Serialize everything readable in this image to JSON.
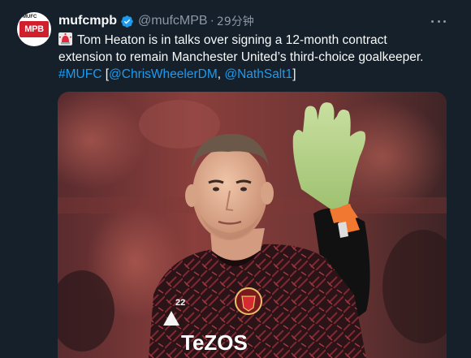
{
  "author": {
    "display_name": "mufcmpb",
    "handle": "@mufcMPB",
    "time": "29分钟",
    "avatar_text": "MPB",
    "avatar_small_text": "MUFC"
  },
  "tweet": {
    "text_main": "Tom Heaton is in talks over signing a 12-month contract extension to remain Manchester United’s third-choice goalkeeper.",
    "hashtag": "#MUFC",
    "bracket_open": "[",
    "mention_1": "@ChrisWheelerDM",
    "separator": ", ",
    "mention_2": "@NathSalt1",
    "bracket_close": "]"
  },
  "media": {
    "shirt_number": "22",
    "sponsor_text": "TeZOS"
  },
  "icons": {
    "verified": "verified-badge-icon",
    "siren": "siren-emoji-icon",
    "more": "more-options-icon"
  },
  "colors": {
    "background": "#15202b",
    "link": "#1d9bf0",
    "verified": "#1d9bf0",
    "secondary_text": "#8b98a5"
  }
}
